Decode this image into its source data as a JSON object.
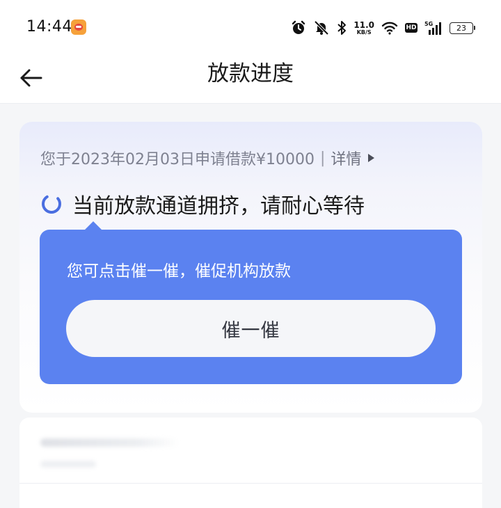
{
  "status_bar": {
    "time": "14:44",
    "net_speed_value": "11.0",
    "net_speed_unit": "KB/S",
    "hd_label": "HD",
    "signal_label": "5G",
    "battery_level": "23",
    "icons": [
      "app-badge-icon",
      "alarm-icon",
      "mute-bell-icon",
      "bluetooth-icon",
      "wifi-icon",
      "hd-icon",
      "signal-icon",
      "battery-icon"
    ]
  },
  "header": {
    "title": "放款进度",
    "back_icon": "arrow-left-icon"
  },
  "progress": {
    "apply_info": "您于2023年02月03日申请借款¥10000",
    "separator": "|",
    "detail_label": "详情",
    "status_text": "当前放款通道拥挤，请耐心等待",
    "status_icon": "loading-spinner-icon"
  },
  "urge": {
    "hint": "您可点击催一催，催促机构放款",
    "button_label": "催一催"
  },
  "colors": {
    "accent": "#5b82f0",
    "spinner": "#4a6ee0",
    "button_bg": "#f5f6f9",
    "page_bg": "#f5f6f8"
  }
}
